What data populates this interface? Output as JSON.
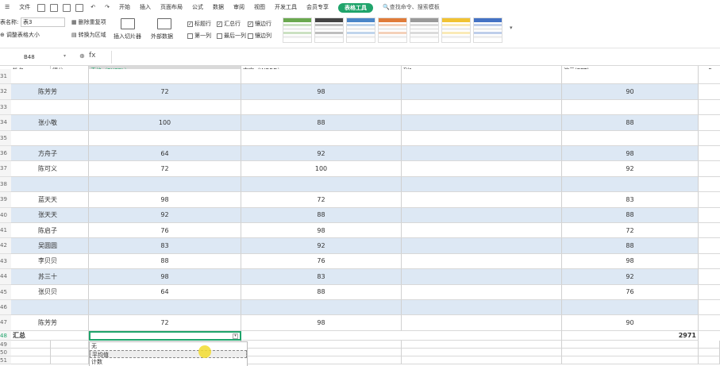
{
  "menu": {
    "file": "文件",
    "items": [
      "开始",
      "插入",
      "页面布局",
      "公式",
      "数据",
      "审阅",
      "视图",
      "开发工具",
      "会员专享"
    ],
    "table_tools": "表格工具",
    "search": "查找命令、搜索模板"
  },
  "ribbon": {
    "table_name_label": "表名称:",
    "table_name_value": "表3",
    "resize_table": "调整表格大小",
    "remove_duplicates": "删除重复项",
    "convert_to_range": "转换为区域",
    "insert_slicer": "插入切片器",
    "external_data": "外部数据",
    "checkboxes": [
      {
        "label": "标题行",
        "checked": true
      },
      {
        "label": "汇总行",
        "checked": true
      },
      {
        "label": "镶边行",
        "checked": true
      },
      {
        "label": "第一列",
        "checked": false
      },
      {
        "label": "最后一列",
        "checked": false
      },
      {
        "label": "镶边列",
        "checked": false
      }
    ],
    "style_colors": [
      "#6aa84f",
      "#444444",
      "#4a86c8",
      "#e07b39",
      "#999999",
      "#f1c232",
      "#4472c4"
    ]
  },
  "formula_bar": {
    "cell_ref": "B48",
    "fx": "fx",
    "content": ""
  },
  "columns": {
    "headers": [
      "姓名",
      "得分",
      "表格（EXCEL）",
      "文字（WORD）",
      "列1",
      "演示(PPT)",
      "F"
    ]
  },
  "rows": [
    {
      "num": "31",
      "name": "",
      "excel": "",
      "word": "",
      "col1": "",
      "ppt": "",
      "band": false
    },
    {
      "num": "32",
      "name": "陈芳芳",
      "excel": "72",
      "word": "98",
      "col1": "",
      "ppt": "90",
      "band": true
    },
    {
      "num": "33",
      "name": "",
      "excel": "",
      "word": "",
      "col1": "",
      "ppt": "",
      "band": false
    },
    {
      "num": "34",
      "name": "张小敬",
      "excel": "100",
      "word": "88",
      "col1": "",
      "ppt": "88",
      "band": true
    },
    {
      "num": "35",
      "name": "",
      "excel": "",
      "word": "",
      "col1": "",
      "ppt": "",
      "band": false
    },
    {
      "num": "36",
      "name": "方舟子",
      "excel": "64",
      "word": "92",
      "col1": "",
      "ppt": "98",
      "band": true
    },
    {
      "num": "37",
      "name": "陈可义",
      "excel": "72",
      "word": "100",
      "col1": "",
      "ppt": "92",
      "band": false
    },
    {
      "num": "38",
      "name": "",
      "excel": "",
      "word": "",
      "col1": "",
      "ppt": "",
      "band": true
    },
    {
      "num": "39",
      "name": "蓝天天",
      "excel": "98",
      "word": "72",
      "col1": "",
      "ppt": "83",
      "band": false
    },
    {
      "num": "40",
      "name": "张天天",
      "excel": "92",
      "word": "88",
      "col1": "",
      "ppt": "88",
      "band": true
    },
    {
      "num": "41",
      "name": "陈启子",
      "excel": "76",
      "word": "98",
      "col1": "",
      "ppt": "72",
      "band": false
    },
    {
      "num": "42",
      "name": "吴圆圆",
      "excel": "83",
      "word": "92",
      "col1": "",
      "ppt": "88",
      "band": true
    },
    {
      "num": "43",
      "name": "李贝贝",
      "excel": "88",
      "word": "76",
      "col1": "",
      "ppt": "98",
      "band": false
    },
    {
      "num": "44",
      "name": "苏三十",
      "excel": "98",
      "word": "83",
      "col1": "",
      "ppt": "92",
      "band": true
    },
    {
      "num": "45",
      "name": "张贝贝",
      "excel": "64",
      "word": "88",
      "col1": "",
      "ppt": "76",
      "band": false
    },
    {
      "num": "46",
      "name": "",
      "excel": "",
      "word": "",
      "col1": "",
      "ppt": "",
      "band": true
    },
    {
      "num": "47",
      "name": "陈芳芳",
      "excel": "72",
      "word": "98",
      "col1": "",
      "ppt": "90",
      "band": false
    }
  ],
  "total_row": {
    "num": "48",
    "label": "汇总",
    "ppt_total": "2971"
  },
  "extra_rows": [
    "49",
    "50",
    "51"
  ],
  "dropdown": {
    "options": [
      "无",
      "平均值",
      "计数"
    ],
    "highlighted_index": 1
  },
  "colors": {
    "band": "#dde8f4",
    "header_bg": "#ffffff",
    "selected_col_header": "#d9d9d9",
    "accent_green": "#1fa46b"
  }
}
